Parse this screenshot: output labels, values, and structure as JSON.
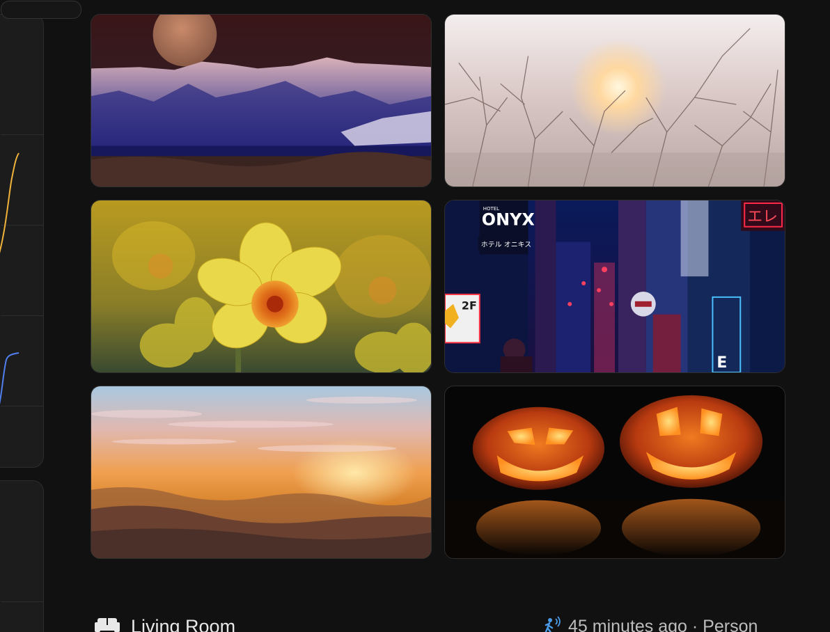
{
  "gallery": {
    "images": [
      {
        "id": "mountain-moon",
        "description": "snowy mountain ridge under full moon"
      },
      {
        "id": "misty-sunrise",
        "description": "sun behind bare branches in fog"
      },
      {
        "id": "daffodil",
        "description": "yellow daffodil flower"
      },
      {
        "id": "city-neon",
        "description": "neon lit alley at night"
      },
      {
        "id": "sunset-hills",
        "description": "orange sunset over hills"
      },
      {
        "id": "jack-o-lanterns",
        "description": "two carved glowing pumpkins"
      }
    ],
    "signs": {
      "hotel_small": "HOTEL",
      "hotel_name": "ONYX",
      "hotel_jp": "ホテル オニキス",
      "floor": "2F",
      "neon_red": "エレ",
      "letter_e": "E"
    }
  },
  "footer": {
    "room_icon": "sofa-icon",
    "room_name": "Living Room",
    "motion_icon": "motion-sensor-icon",
    "status": "45 minutes ago · Person"
  },
  "colors": {
    "background": "#111111",
    "card": "#1c1c1c",
    "spark_yellow": "#f0b23a",
    "spark_blue": "#4f7ff0",
    "motion_blue": "#4a9be8"
  }
}
